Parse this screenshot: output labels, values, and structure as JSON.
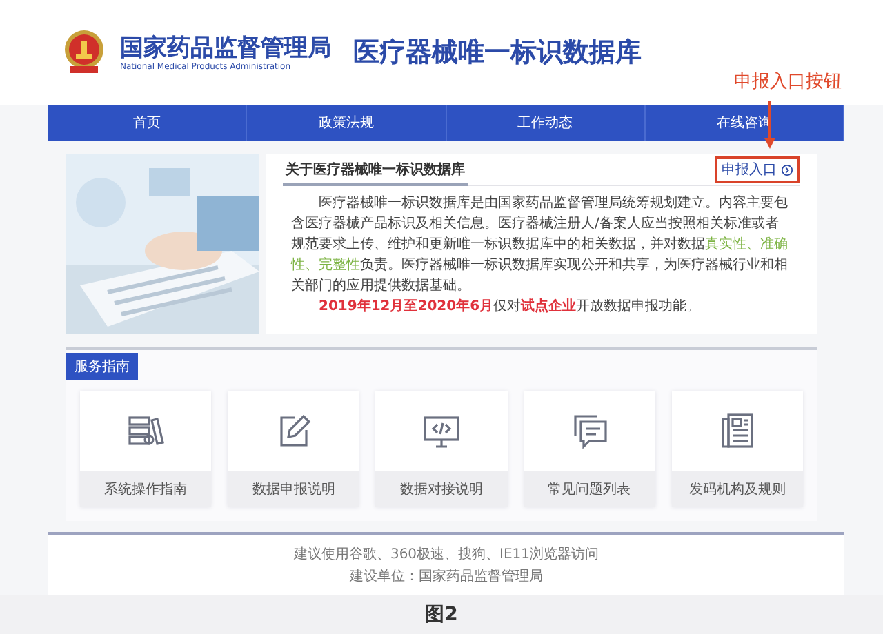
{
  "header": {
    "agency_name": "国家药品监督管理局",
    "agency_name_en": "National Medical Products Administration",
    "site_title": "医疗器械唯一标识数据库"
  },
  "annotation": {
    "label": "申报入口按钮"
  },
  "nav": [
    "首页",
    "政策法规",
    "工作动态",
    "在线咨询"
  ],
  "about": {
    "title": "关于医疗器械唯一标识数据库",
    "button": "申报入口",
    "paragraphs": [
      [
        {
          "kind": "plain",
          "text": "医疗器械唯一标识数据库是由国家药品监督管理局统筹规划建立。内容主要包含医疗器械产品标识及相关信息。医疗器械注册人/备案人应当按照相关标准或者规范要求上传、维护和更新唯一标识数据库中的相关数据，并对数据"
        },
        {
          "kind": "green",
          "text": "真实性、准确性、完整性"
        },
        {
          "kind": "plain",
          "text": "负责。医疗器械唯一标识数据库实现公开和共享，为医疗器械行业和相关部门的应用提供数据基础。"
        }
      ],
      [
        {
          "kind": "red",
          "text": "2019年12月至2020年6月"
        },
        {
          "kind": "plain",
          "text": "仅对"
        },
        {
          "kind": "red",
          "text": "试点企业"
        },
        {
          "kind": "plain",
          "text": "开放数据申报功能。"
        }
      ]
    ]
  },
  "service": {
    "title": "服务指南",
    "items": [
      "系统操作指南",
      "数据申报说明",
      "数据对接说明",
      "常见问题列表",
      "发码机构及规则"
    ]
  },
  "footer": [
    "建议使用谷歌、360极速、搜狗、IE11浏览器访问",
    "建设单位：国家药品监督管理局"
  ],
  "caption": "图2"
}
